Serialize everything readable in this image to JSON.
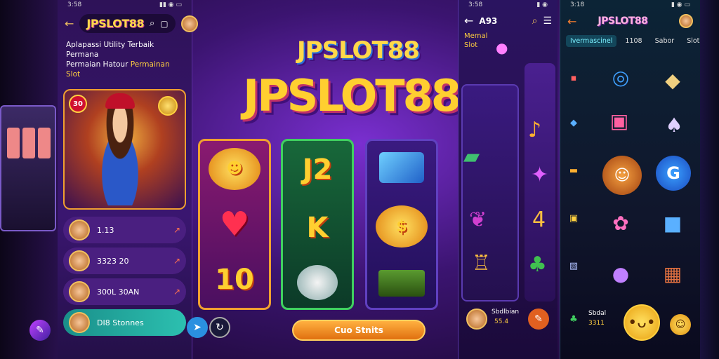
{
  "phone1": {
    "status_time": "3:58",
    "logo": "JPSLOT88",
    "tagline_line1": "Aplapassi Utility Terbaik  Permana",
    "tagline_line2_pre": "Permaian Hatour ",
    "tagline_line2_hl": "Permainan Slot",
    "hero_badge": "30",
    "rows": [
      {
        "text": "1.13",
        "arrow": "↗"
      },
      {
        "text": "3323 20",
        "arrow": "↗"
      },
      {
        "text": "300L 30AN",
        "arrow": "↗"
      },
      {
        "text": "DI8 Stonnes",
        "arrow": ""
      }
    ]
  },
  "center": {
    "logo_small": "JPSLOT88",
    "logo_big": "JPSLOT88",
    "reel1": [
      "☻",
      "♥",
      "10"
    ],
    "reel2": [
      "J2",
      "K",
      ""
    ],
    "reel3": [
      "",
      "$",
      ""
    ],
    "button": "Cuo Stnits"
  },
  "phone2": {
    "status_time": "3:58",
    "title": "A93",
    "sub1": "Memal",
    "sub2": "Slot",
    "footer_name": "Sbdlbian",
    "footer_value": "55.4"
  },
  "phone3": {
    "status_time": "3:18",
    "logo": "JPSLOT88",
    "tabs": [
      "Ivermascinel",
      "1108",
      "Sabor",
      "Slot"
    ],
    "footer_name": "Sbdal",
    "footer_value": "3311"
  }
}
